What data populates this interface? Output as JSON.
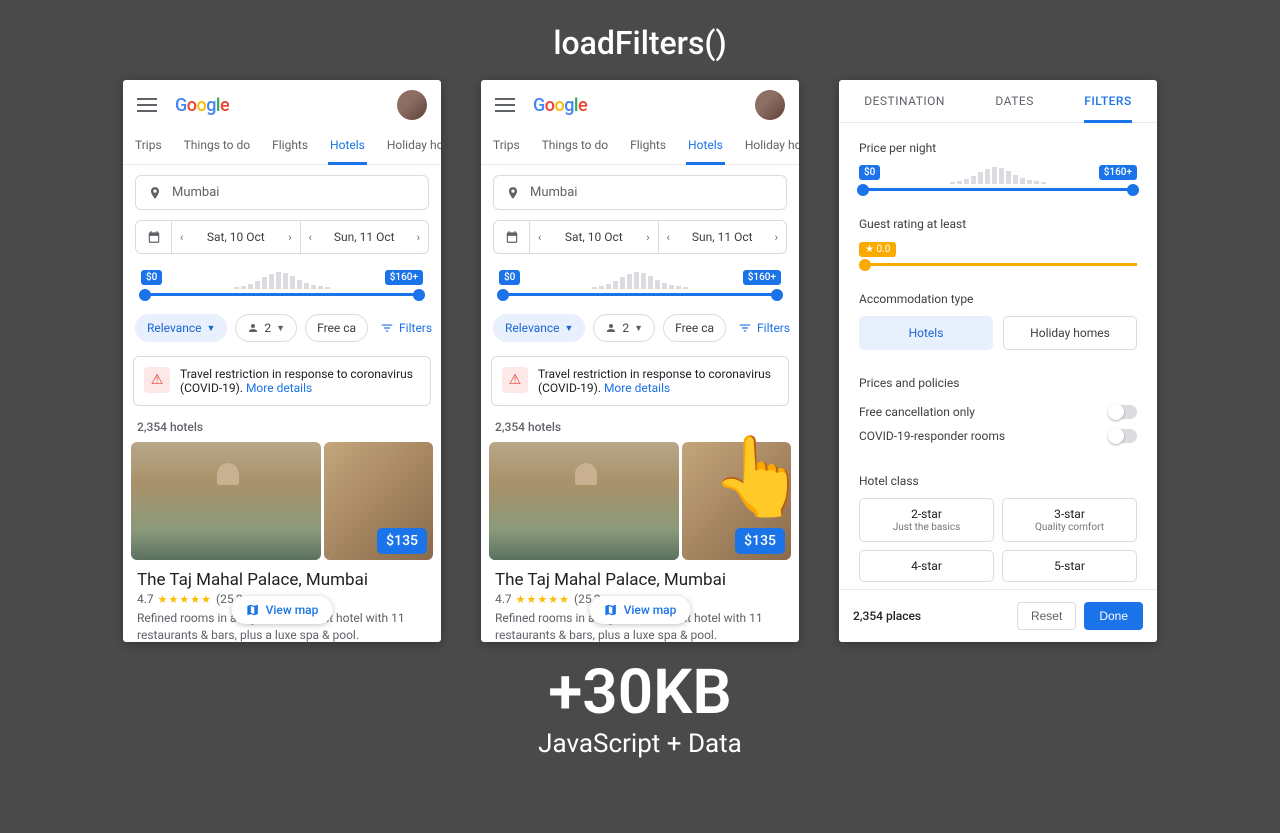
{
  "slide": {
    "title": "loadFilters()",
    "size_line": "+30KB",
    "size_sub": "JavaScript + Data"
  },
  "app": {
    "logo": "Google",
    "nav_tabs": [
      "Trips",
      "Things to do",
      "Flights",
      "Hotels",
      "Holiday homes"
    ],
    "active_tab": "Hotels",
    "search": {
      "location": "Mumbai",
      "checkin": "Sat, 10 Oct",
      "checkout": "Sun, 11 Oct"
    },
    "price_slider": {
      "min": "$0",
      "max": "$160+"
    },
    "chips": {
      "sort": "Relevance",
      "guests": "2",
      "freecancel": "Free cancellation",
      "filters": "Filters"
    },
    "notice": {
      "text": "Travel restriction in response to coronavirus (COVID-19). ",
      "link": "More details"
    },
    "results_count": "2,354 hotels",
    "hotel": {
      "name": "The Taj Mahal Palace, Mumbai",
      "rating": "4.7",
      "reviews_partial": "(25,2",
      "price": "$135",
      "desc": "Refined rooms in a high-end seafront hotel with 11 restaurants & bars, plus a luxe spa & pool."
    },
    "view_map": "View map"
  },
  "filters": {
    "tabs": [
      "DESTINATION",
      "DATES",
      "FILTERS"
    ],
    "active_tab": "FILTERS",
    "price_label": "Price per night",
    "price_min": "$0",
    "price_max": "$160+",
    "rating_label": "Guest rating at least",
    "rating_value": "★ 0.0",
    "accom_label": "Accommodation type",
    "accom": [
      "Hotels",
      "Holiday homes"
    ],
    "policies_label": "Prices and policies",
    "policies": [
      "Free cancellation only",
      "COVID-19-responder rooms"
    ],
    "class_label": "Hotel class",
    "classes": [
      {
        "t": "2-star",
        "s": "Just the basics"
      },
      {
        "t": "3-star",
        "s": "Quality comfort"
      },
      {
        "t": "4-star",
        "s": ""
      },
      {
        "t": "5-star",
        "s": ""
      }
    ],
    "footer_count": "2,354 places",
    "reset": "Reset",
    "done": "Done"
  }
}
